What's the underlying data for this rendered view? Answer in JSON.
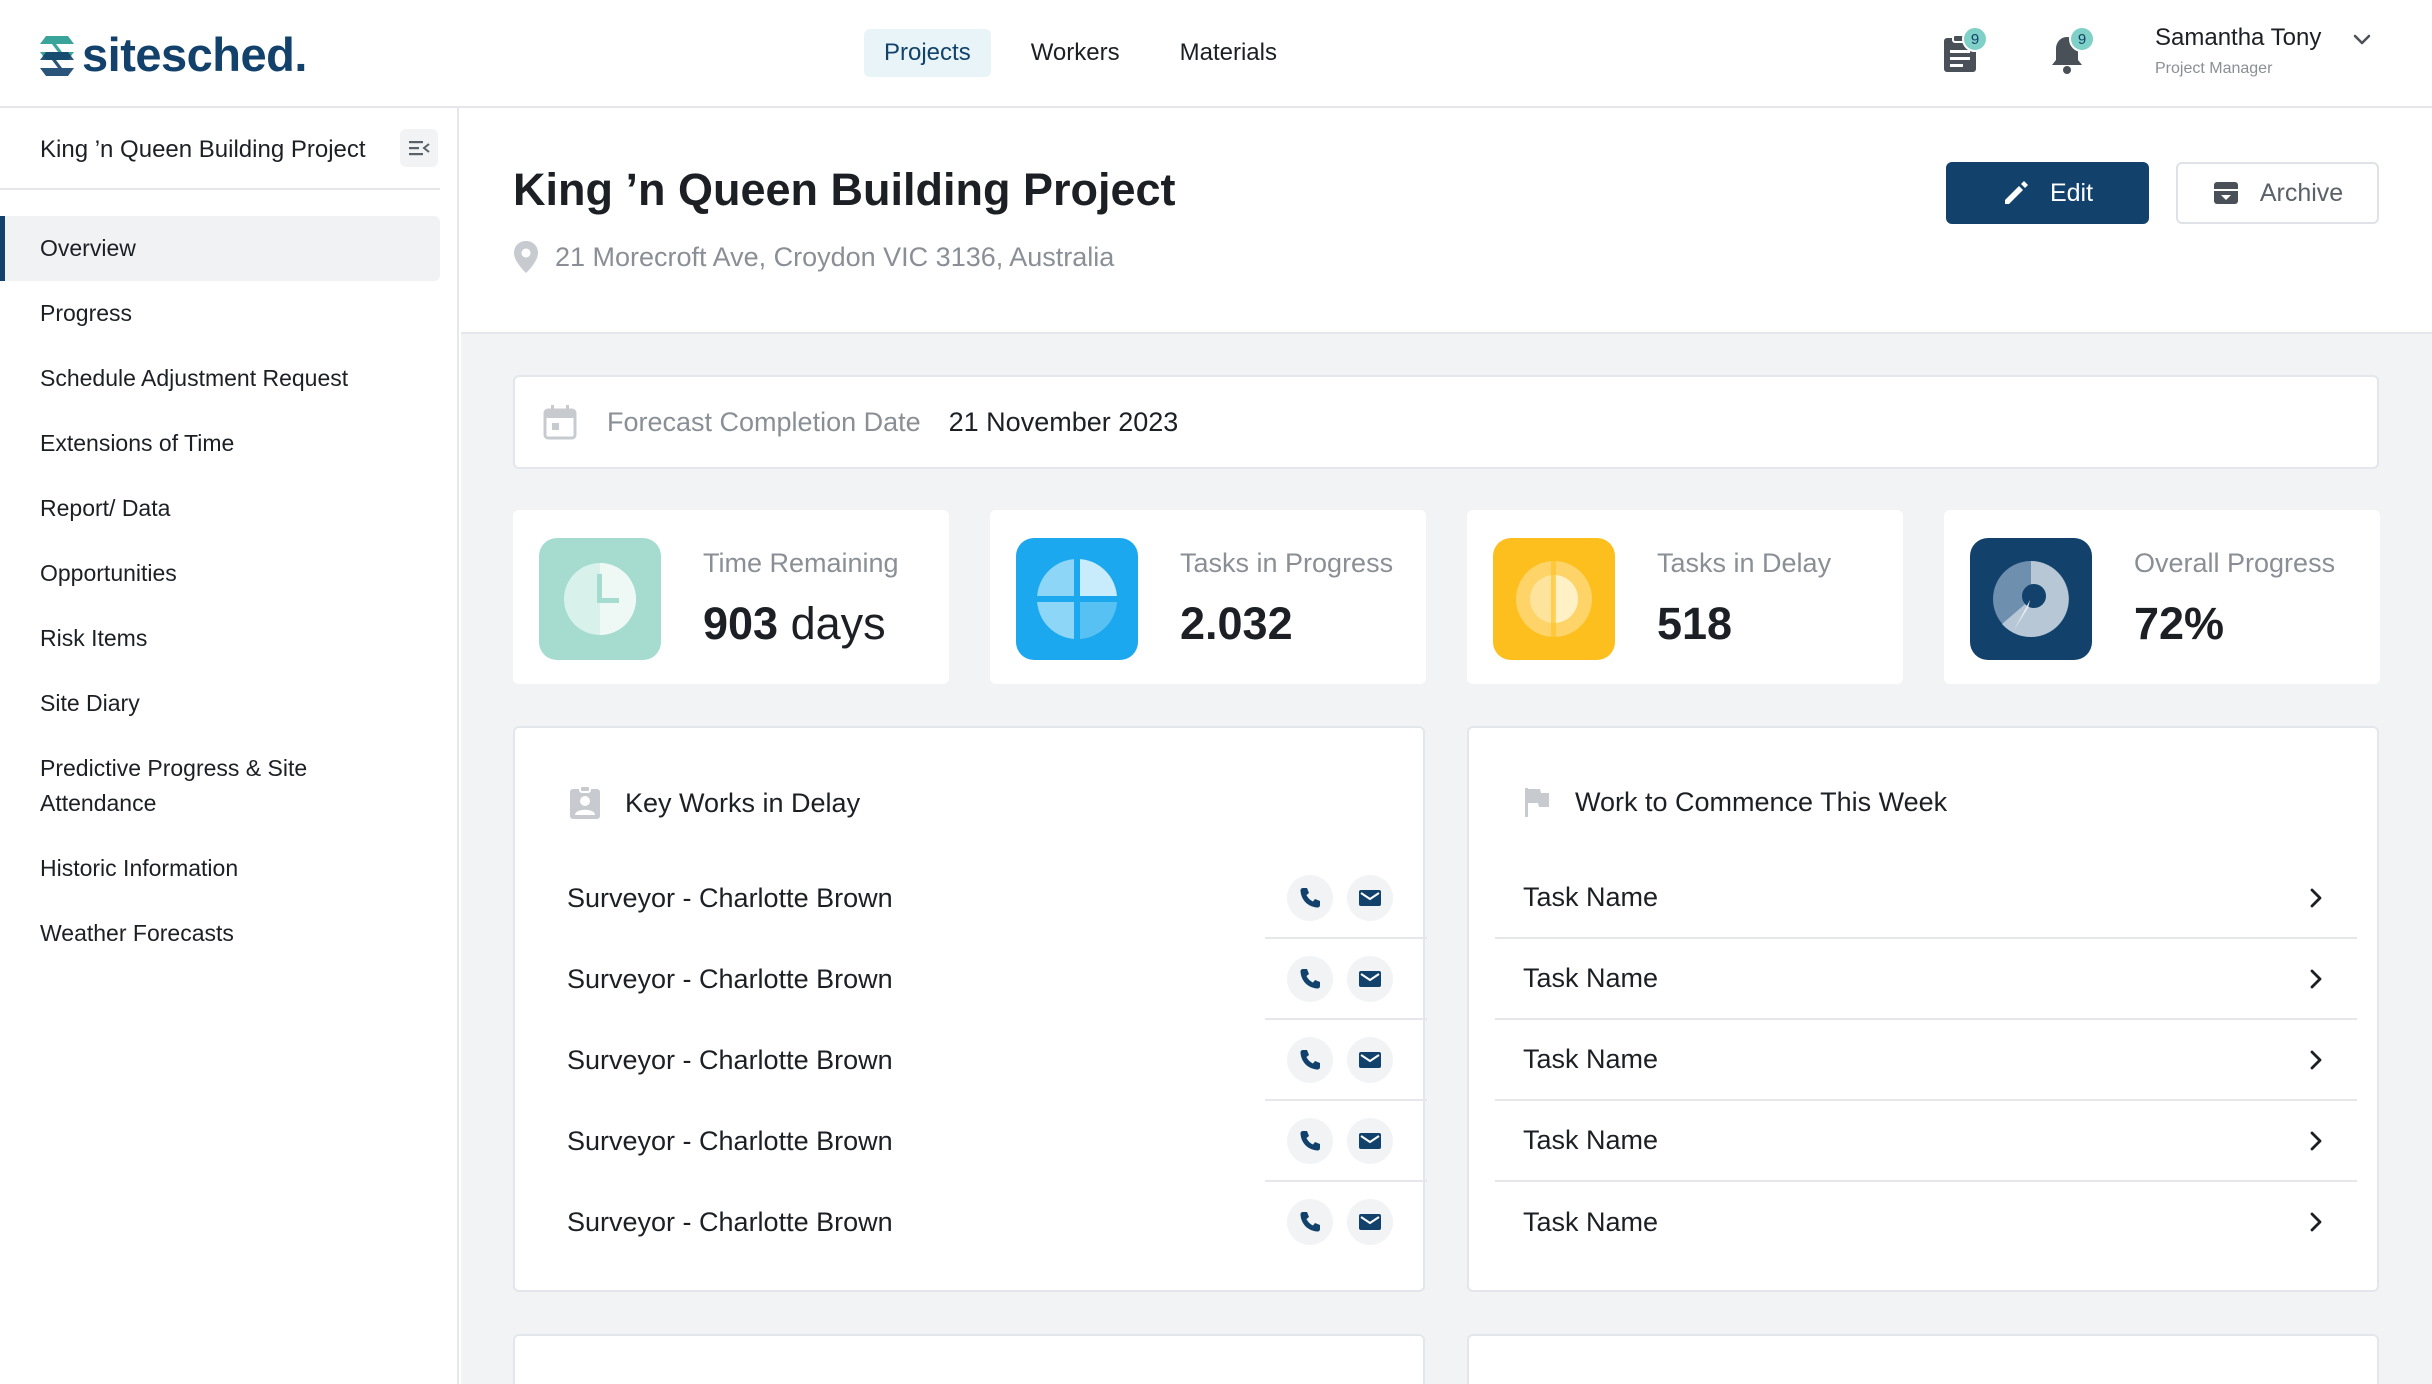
{
  "brand": {
    "name": "sitesched."
  },
  "nav": {
    "items": [
      {
        "label": "Projects",
        "active": true
      },
      {
        "label": "Workers"
      },
      {
        "label": "Materials"
      }
    ]
  },
  "topbar": {
    "documents_badge": "9",
    "notifications_badge": "9",
    "user": {
      "name": "Samantha Tony",
      "role": "Project Manager"
    }
  },
  "sidebar": {
    "project_title": "King ’n Queen Building Project",
    "items": [
      {
        "label": "Overview",
        "active": true
      },
      {
        "label": "Progress"
      },
      {
        "label": "Schedule Adjustment Request"
      },
      {
        "label": "Extensions of Time"
      },
      {
        "label": "Report/ Data"
      },
      {
        "label": "Opportunities"
      },
      {
        "label": "Risk Items"
      },
      {
        "label": "Site Diary"
      },
      {
        "label": "Predictive Progress & Site Attendance"
      },
      {
        "label": "Historic Information"
      },
      {
        "label": "Weather Forecasts"
      }
    ]
  },
  "project": {
    "title": "King ’n Queen Building Project",
    "address": "21 Morecroft Ave, Croydon VIC 3136, Australia",
    "edit_label": "Edit",
    "archive_label": "Archive"
  },
  "forecast": {
    "label": "Forecast Completion Date",
    "value": "21 November 2023"
  },
  "stats": [
    {
      "label": "Time Remaining",
      "value": "903",
      "unit": " days",
      "color": "#9fd9cd"
    },
    {
      "label": "Tasks in Progress",
      "value": "2.032",
      "unit": "",
      "color": "#1ca8ef"
    },
    {
      "label": "Tasks in Delay",
      "value": "518",
      "unit": "",
      "color": "#fdbf1d"
    },
    {
      "label": "Overall Progress",
      "value": "72%",
      "unit": "",
      "color": "#12426b"
    }
  ],
  "key_works": {
    "title": "Key Works in Delay",
    "rows": [
      "Surveyor - Charlotte Brown",
      "Surveyor - Charlotte Brown",
      "Surveyor - Charlotte Brown",
      "Surveyor - Charlotte Brown",
      "Surveyor - Charlotte Brown"
    ]
  },
  "work_to_commence": {
    "title": "Work to Commence This Week",
    "rows": [
      "Task Name",
      "Task Name",
      "Task Name",
      "Task Name",
      "Task Name"
    ]
  },
  "colors": {
    "primary": "#12426b",
    "accent": "#7fd0c7",
    "background": "#f1f3f5"
  }
}
